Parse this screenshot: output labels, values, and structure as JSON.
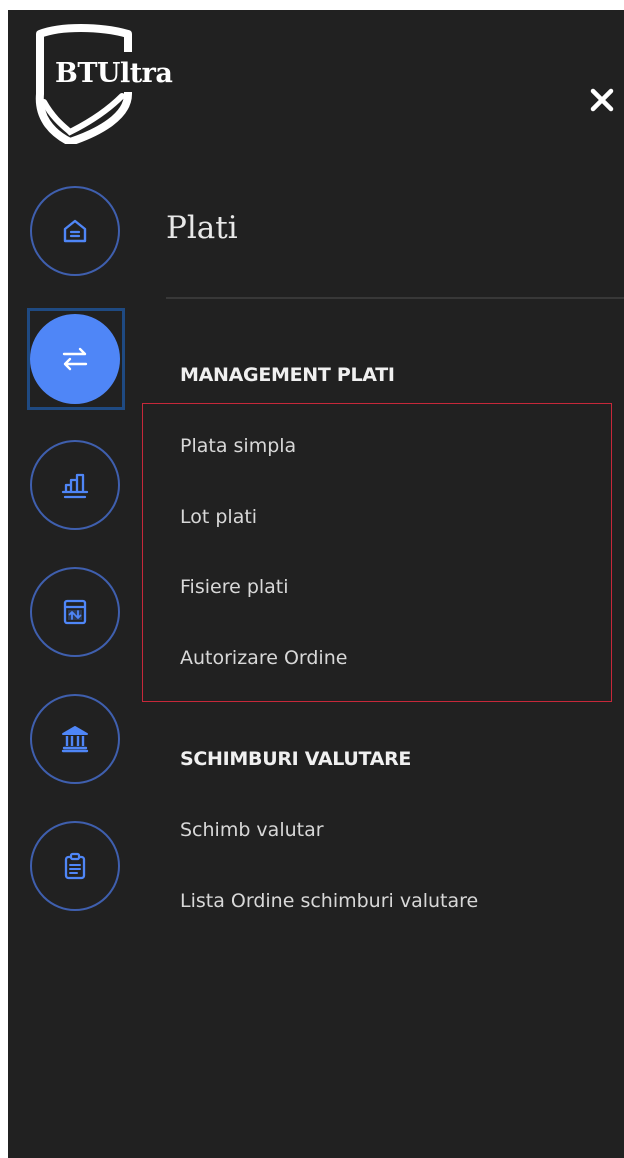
{
  "logo": {
    "text": "BTUltra"
  },
  "header": {
    "close_icon": "close-icon"
  },
  "sidebar": {
    "items": [
      {
        "icon": "home-icon",
        "active": false
      },
      {
        "icon": "transfer-arrows-icon",
        "active": true
      },
      {
        "icon": "bar-chart-icon",
        "active": false
      },
      {
        "icon": "calendar-exchange-icon",
        "active": false
      },
      {
        "icon": "bank-icon",
        "active": false
      },
      {
        "icon": "clipboard-icon",
        "active": false
      }
    ]
  },
  "main": {
    "title": "Plati",
    "groups": [
      {
        "heading": "MANAGEMENT PLATI",
        "items": [
          "Plata simpla",
          "Lot plati",
          "Fisiere plati",
          "Autorizare Ordine"
        ]
      },
      {
        "heading": "SCHIMBURI VALUTARE",
        "items": [
          "Schimb valutar",
          "Lista Ordine schimburi valutare"
        ]
      }
    ]
  },
  "colors": {
    "background": "#212121",
    "accent": "#4f86f7",
    "icon_ring": "#3f5fae",
    "highlight": "#c7283a"
  }
}
